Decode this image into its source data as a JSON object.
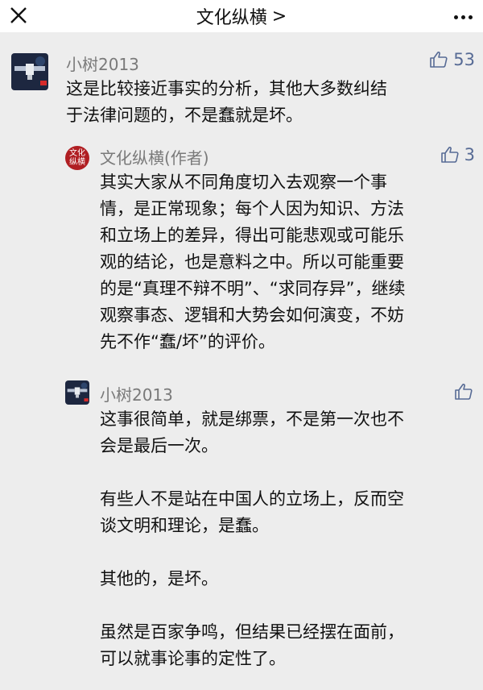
{
  "header": {
    "title": "文化纵横",
    "chevron": ">",
    "close_icon": "close-icon",
    "more_icon": "more-icon"
  },
  "comments": [
    {
      "user": "小树2013",
      "likes": "53",
      "avatar_icon": "space-station-avatar",
      "text": [
        "这是比较接近事实的分析，其他大多数纠结",
        "于法律问题的，不是蠢就是坏。"
      ]
    }
  ],
  "replies": [
    {
      "user": "文化纵横(作者)",
      "likes": "3",
      "avatar_text": [
        "文化",
        "纵横"
      ],
      "lines": [
        "其实大家从不同角度切入去观察一个事",
        "情，是正常现象；每个人因为知识、方法",
        "和立场上的差异，得出可能悲观或可能乐",
        "观的结论，也是意料之中。所以可能重要",
        "的是“真理不辩不明”、“求同存异”，继续",
        "观察事态、逻辑和大势会如何演变，不妨",
        "先不作“蠢/坏”的评价。"
      ]
    },
    {
      "user": "小树2013",
      "likes": "",
      "avatar_icon": "space-station-avatar",
      "paragraphs": [
        [
          "这事很简单，就是绑票，不是第一次也不",
          "会是最后一次。"
        ],
        [
          "有些人不是站在中国人的立场上，反而空",
          "谈文明和理论，是蠢。"
        ],
        [
          "其他的，是坏。"
        ],
        [
          "虽然是百家争鸣，但结果已经摆在面前，",
          "可以就事论事的定性了。"
        ]
      ]
    }
  ],
  "colors": {
    "background": "#ededed",
    "link_blue": "#576b95",
    "name_gray": "#7a7a7a",
    "author_red": "#b01e22"
  }
}
